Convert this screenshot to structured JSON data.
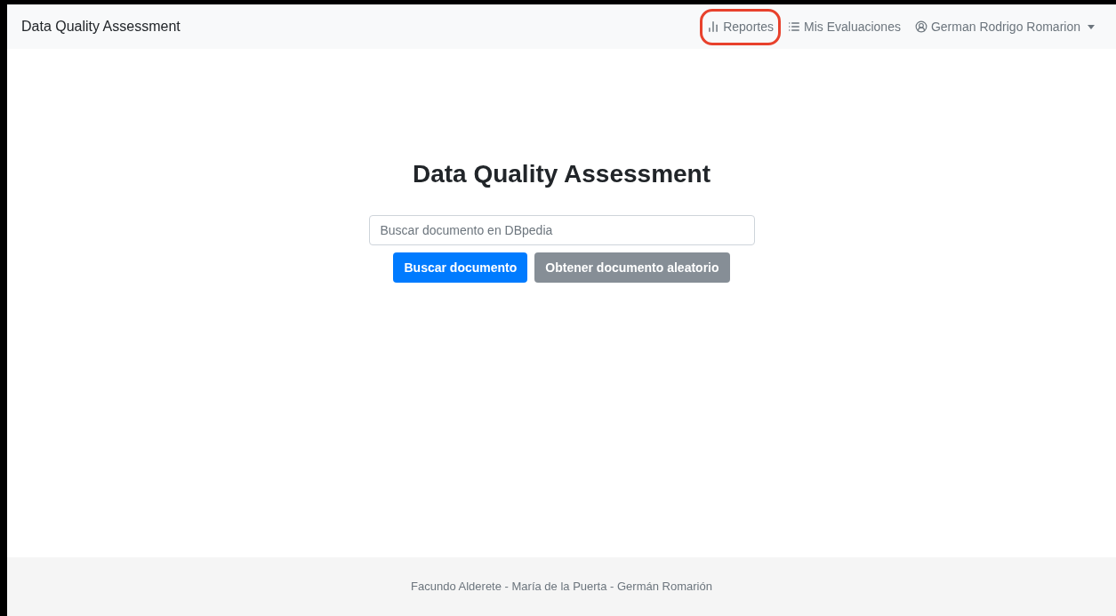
{
  "navbar": {
    "brand": "Data Quality Assessment",
    "items": [
      {
        "label": "Reportes",
        "kind": "link",
        "highlighted": true
      },
      {
        "label": "Mis Evaluaciones",
        "kind": "link",
        "highlighted": false
      },
      {
        "label": "German Rodrigo Romarion",
        "kind": "dropdown",
        "highlighted": false
      }
    ]
  },
  "main": {
    "title": "Data Quality Assessment",
    "search": {
      "placeholder": "Buscar documento en DBpedia"
    },
    "buttons": [
      {
        "label": "Buscar documento",
        "kind": "primary"
      },
      {
        "label": "Obtener documento aleatorio",
        "kind": "secondary"
      }
    ]
  },
  "footer": {
    "text": "Facundo Alderete - María de la Puerta - Germán Romarión"
  }
}
